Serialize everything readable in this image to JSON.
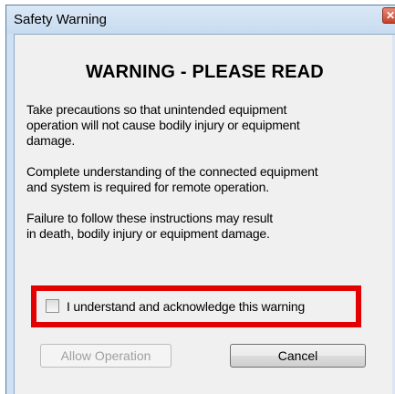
{
  "window": {
    "title": "Safety Warning",
    "close_icon": "close-icon",
    "close_symbol": "✕",
    "colors": {
      "frame": "#cfe0f2",
      "client": "#f0f0f0",
      "highlight": "#e20000",
      "close_button": "#c7412a"
    }
  },
  "content": {
    "heading": "WARNING - PLEASE READ",
    "paragraph1": [
      "Take precautions so that unintended equipment",
      "operation will not cause bodily injury or equipment",
      "damage."
    ],
    "paragraph2": [
      "Complete understanding of the connected equipment",
      "and system is required for remote operation."
    ],
    "paragraph3": [
      "Failure to follow these instructions may result",
      "in death, bodily injury or equipment damage."
    ]
  },
  "acknowledge": {
    "label": "I understand and acknowledge this warning",
    "checked": false
  },
  "buttons": {
    "allow": {
      "label": "Allow Operation",
      "enabled": false
    },
    "cancel": {
      "label": "Cancel",
      "enabled": true
    }
  }
}
